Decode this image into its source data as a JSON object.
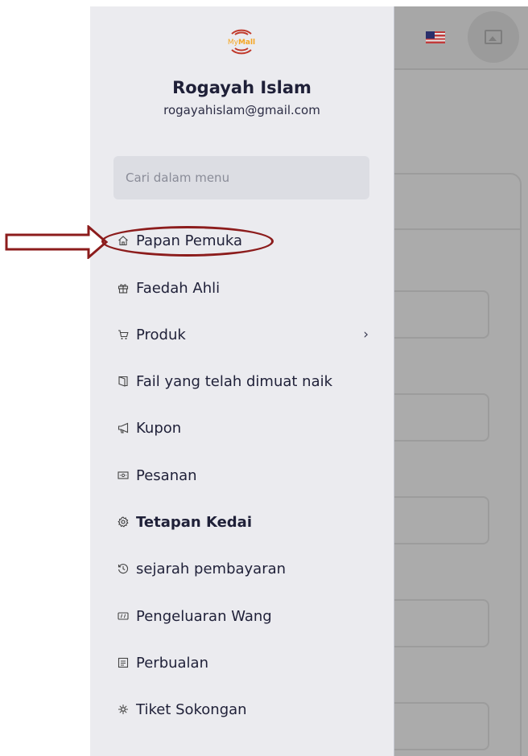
{
  "app": {
    "logo_text_my": "My",
    "logo_text_mall": "Mall",
    "flag_icon": "malaysia-flag-icon",
    "avatar_icon": "image-placeholder-icon"
  },
  "user": {
    "name": "Rogayah Islam",
    "email": "rogayahislam@gmail.com"
  },
  "search": {
    "placeholder": "Cari dalam menu",
    "value": ""
  },
  "menu": {
    "items": [
      {
        "label": "Papan Pemuka",
        "icon": "home-icon"
      },
      {
        "label": "Faedah Ahli",
        "icon": "gift-icon"
      },
      {
        "label": "Produk",
        "icon": "cart-icon",
        "has_submenu": true,
        "chevron": "›"
      },
      {
        "label": "Fail yang telah dimuat naik",
        "icon": "file-icon"
      },
      {
        "label": "Kupon",
        "icon": "megaphone-icon"
      },
      {
        "label": "Pesanan",
        "icon": "order-icon"
      },
      {
        "label": "Tetapan Kedai",
        "icon": "gear-icon",
        "active": true
      },
      {
        "label": "sejarah pembayaran",
        "icon": "history-icon"
      },
      {
        "label": "Pengeluaran Wang",
        "icon": "money-icon"
      },
      {
        "label": "Perbualan",
        "icon": "chat-icon"
      },
      {
        "label": "Tiket Sokongan",
        "icon": "support-icon"
      }
    ]
  },
  "colors": {
    "annotation": "#8c1c1c",
    "drawer_bg": "#ebebef",
    "text": "#1f2038",
    "logo_orange": "#f5a623",
    "logo_red": "#c0392b"
  }
}
